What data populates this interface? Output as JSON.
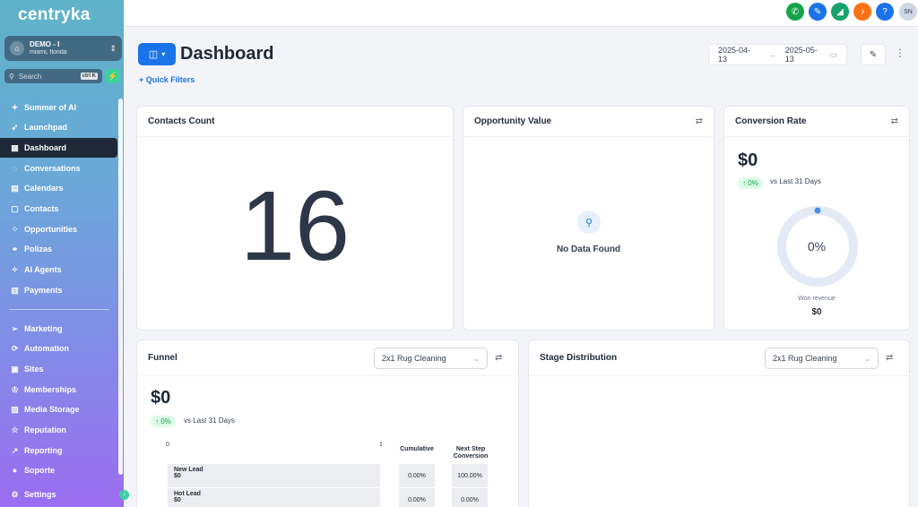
{
  "brand": {
    "name": "centryka",
    "dot": "."
  },
  "account": {
    "name": "DEMO - I",
    "location": "miami, florida"
  },
  "search": {
    "placeholder": "Search",
    "shortcut": "ctrl K"
  },
  "nav": [
    {
      "label": "Summer of AI",
      "icon": "sparkle-icon",
      "glyph": "✦"
    },
    {
      "label": "Launchpad",
      "icon": "rocket-icon",
      "glyph": "➹"
    },
    {
      "label": "Dashboard",
      "icon": "grid-icon",
      "glyph": "▦",
      "active": true
    },
    {
      "label": "Conversations",
      "icon": "chat-icon",
      "glyph": "◌"
    },
    {
      "label": "Calendars",
      "icon": "calendar-icon",
      "glyph": "▤"
    },
    {
      "label": "Contacts",
      "icon": "contacts-icon",
      "glyph": "▢"
    },
    {
      "label": "Opportunities",
      "icon": "opportunities-icon",
      "glyph": "⁘"
    },
    {
      "label": "Polizas",
      "icon": "polizas-icon",
      "glyph": "⚭"
    },
    {
      "label": "AI Agents",
      "icon": "ai-agents-icon",
      "glyph": "✧"
    },
    {
      "label": "Payments",
      "icon": "payments-icon",
      "glyph": "▥"
    },
    {
      "label": "Marketing",
      "icon": "send-icon",
      "glyph": "➢"
    },
    {
      "label": "Automation",
      "icon": "automation-icon",
      "glyph": "⟳"
    },
    {
      "label": "Sites",
      "icon": "sites-icon",
      "glyph": "▣"
    },
    {
      "label": "Memberships",
      "icon": "memberships-icon",
      "glyph": "♔"
    },
    {
      "label": "Media Storage",
      "icon": "media-icon",
      "glyph": "▨"
    },
    {
      "label": "Reputation",
      "icon": "star-icon",
      "glyph": "☆"
    },
    {
      "label": "Reporting",
      "icon": "reporting-icon",
      "glyph": "↗"
    },
    {
      "label": "Soporte",
      "icon": "support-icon",
      "glyph": "●"
    },
    {
      "label": "Settings",
      "icon": "gear-icon",
      "glyph": "⚙"
    }
  ],
  "topbar": {
    "icons": [
      {
        "name": "phone-icon",
        "glyph": "✆",
        "color": "#16a34a"
      },
      {
        "name": "magic-icon",
        "glyph": "✎",
        "color": "#1a73e8"
      },
      {
        "name": "megaphone-icon",
        "glyph": "◢",
        "color": "#15a36b"
      },
      {
        "name": "bell-icon",
        "glyph": "♪",
        "color": "#f97316"
      },
      {
        "name": "help-icon",
        "glyph": "?",
        "color": "#1a73e8"
      }
    ],
    "avatar": "SN"
  },
  "header": {
    "title": "Dashboard",
    "quick_filters": "+  Quick Filters",
    "date_from": "2025-04-13",
    "date_to": "2025-05-13"
  },
  "cards": {
    "contacts": {
      "title": "Contacts Count",
      "value": "16"
    },
    "opportunity": {
      "title": "Opportunity Value",
      "empty": "No Data Found"
    },
    "conversion": {
      "title": "Conversion Rate",
      "amount": "$0",
      "change": "↑ 0%",
      "vs": "vs Last 31 Days",
      "donut_percent": "0%",
      "donut_fraction": 0,
      "won_label": "Won revenue",
      "won_value": "$0"
    },
    "funnel": {
      "title": "Funnel",
      "pipeline": "2x1 Rug Cleaning",
      "amount": "$0",
      "change": "↑ 0%",
      "vs": "vs Last 31 Days",
      "axis_min": "0",
      "axis_max": "1",
      "col_cumulative": "Cumulative",
      "col_next": "Next Step Conversion",
      "rows": [
        {
          "stage": "New Lead",
          "value": "$0",
          "cumulative": "0.00%",
          "next": "100.00%"
        },
        {
          "stage": "Hot Lead",
          "value": "$0",
          "cumulative": "0.00%",
          "next": "0.00%"
        }
      ]
    },
    "stage": {
      "title": "Stage Distribution",
      "pipeline": "2x1 Rug Cleaning"
    }
  },
  "colors": {
    "primary": "#1a73e8",
    "success": "#16a34a",
    "sidebar_active": "#1f2937"
  }
}
